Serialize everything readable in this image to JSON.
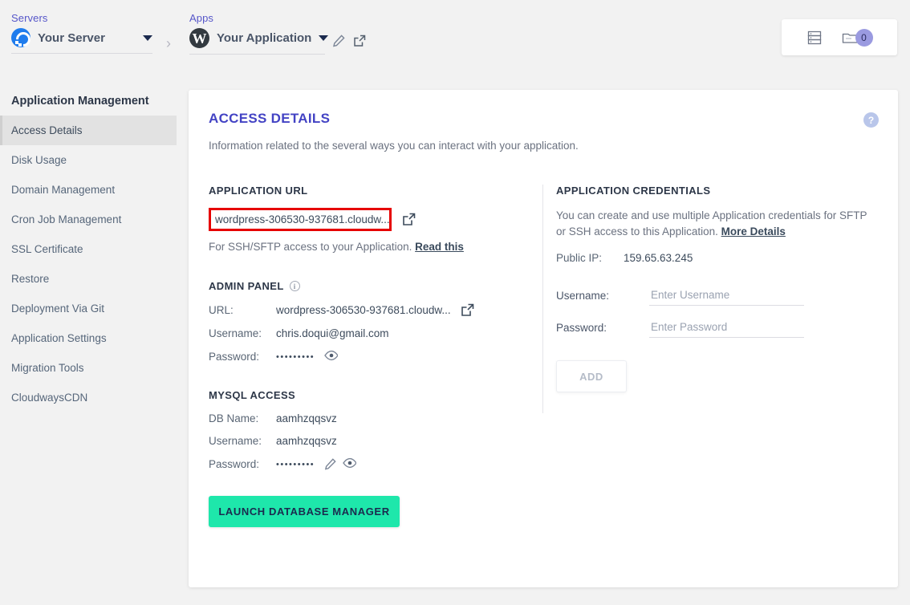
{
  "topbar": {
    "servers_label": "Servers",
    "server_name": "Your Server",
    "apps_label": "Apps",
    "app_name": "Your Application",
    "folder_badge_count": "0"
  },
  "sidebar": {
    "title": "Application Management",
    "items": [
      {
        "label": "Access Details",
        "active": true
      },
      {
        "label": "Disk Usage",
        "active": false
      },
      {
        "label": "Domain Management",
        "active": false
      },
      {
        "label": "Cron Job Management",
        "active": false
      },
      {
        "label": "SSL Certificate",
        "active": false
      },
      {
        "label": "Restore",
        "active": false
      },
      {
        "label": "Deployment Via Git",
        "active": false
      },
      {
        "label": "Application Settings",
        "active": false
      },
      {
        "label": "Migration Tools",
        "active": false
      },
      {
        "label": "CloudwaysCDN",
        "active": false
      }
    ]
  },
  "card": {
    "title": "ACCESS DETAILS",
    "subtitle": "Information related to the several ways you can interact with your application.",
    "help_symbol": "?"
  },
  "application_url": {
    "heading": "APPLICATION URL",
    "url": "wordpress-306530-937681.cloudw...",
    "note_prefix": "For SSH/SFTP access to your Application.",
    "note_link": "Read this"
  },
  "admin_panel": {
    "heading": "ADMIN PANEL",
    "info_symbol": "i",
    "url_label": "URL:",
    "url_value": "wordpress-306530-937681.cloudw...",
    "username_label": "Username:",
    "username_value": "chris.doqui@gmail.com",
    "password_label": "Password:",
    "password_value": "•••••••••"
  },
  "mysql_access": {
    "heading": "MYSQL ACCESS",
    "db_name_label": "DB Name:",
    "db_name_value": "aamhzqqsvz",
    "username_label": "Username:",
    "username_value": "aamhzqqsvz",
    "password_label": "Password:",
    "password_value": "•••••••••",
    "launch_button": "LAUNCH DATABASE MANAGER"
  },
  "application_credentials": {
    "heading": "APPLICATION CREDENTIALS",
    "description": "You can create and use multiple Application credentials for SFTP or SSH access to this Application.",
    "description_link": "More Details",
    "public_ip_label": "Public IP:",
    "public_ip_value": "159.65.63.245",
    "username_label": "Username:",
    "username_placeholder": "Enter Username",
    "username_value": "",
    "password_label": "Password:",
    "password_placeholder": "Enter Password",
    "password_value": "",
    "add_button": "ADD"
  },
  "colors": {
    "accent_purple": "#4343c4",
    "highlight_red": "#e60000",
    "launch_green": "#1ee7ab",
    "badge_purple": "#9a9ae0",
    "page_bg": "#f2f2f2"
  }
}
